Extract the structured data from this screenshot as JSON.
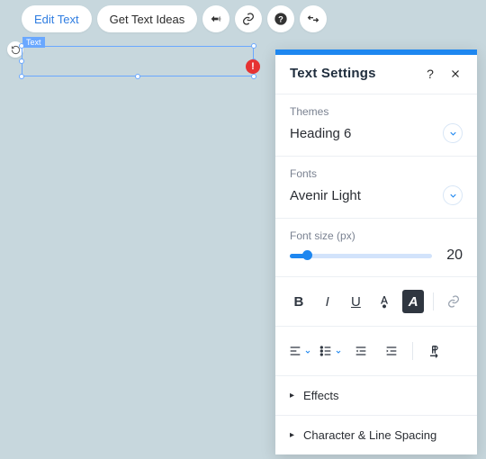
{
  "toolbar": {
    "edit_text": "Edit Text",
    "get_ideas": "Get Text Ideas"
  },
  "textbox_label": "Text",
  "panel": {
    "title": "Text Settings",
    "themes": {
      "label": "Themes",
      "value": "Heading 6"
    },
    "fonts": {
      "label": "Fonts",
      "value": "Avenir Light"
    },
    "fontsize": {
      "label": "Font size (px)",
      "value": "20"
    },
    "effects_label": "Effects",
    "spacing_label": "Character & Line Spacing"
  }
}
